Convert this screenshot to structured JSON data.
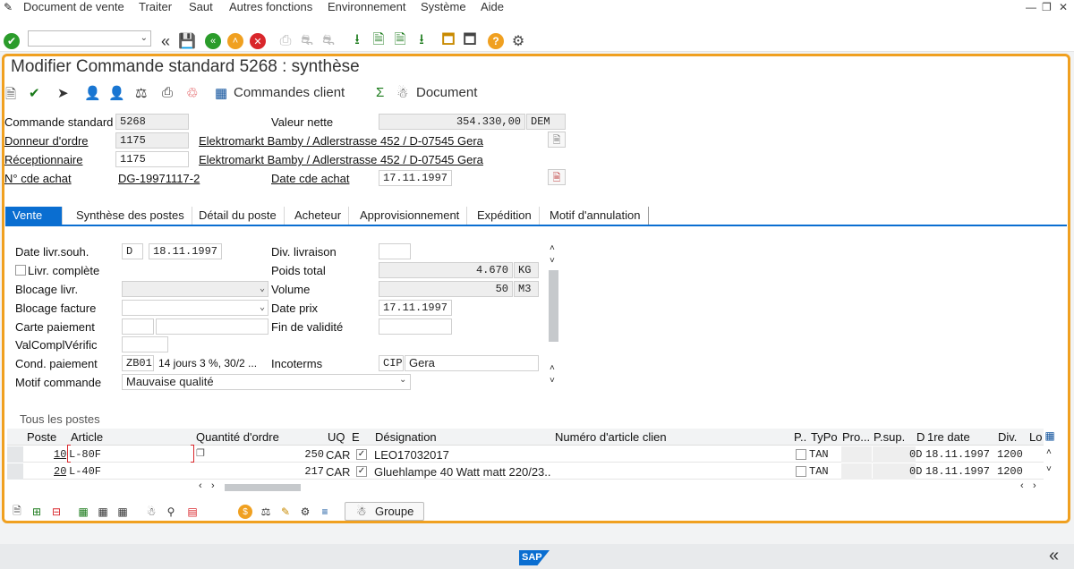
{
  "menu": {
    "items": [
      "Document de vente",
      "Traiter",
      "Saut",
      "Autres fonctions",
      "Environnement",
      "Système",
      "Aide"
    ]
  },
  "title": "Modifier Commande standard 5268 : synthèse",
  "app_toolbar": {
    "commandes_client": "Commandes client",
    "document": "Document"
  },
  "header": {
    "commande_standard_label": "Commande standard",
    "commande_standard_value": "5268",
    "valeur_nette_label": "Valeur nette",
    "valeur_nette_value": "354.330,00",
    "devise": "DEM",
    "donneur_label": "Donneur d'ordre",
    "donneur_value": "1175",
    "donneur_name": "Elektromarkt Bamby / Adlerstrasse 452 / D-07545 Gera",
    "receptionnaire_label": "Réceptionnaire",
    "receptionnaire_value": "1175",
    "receptionnaire_name": "Elektromarkt Bamby / Adlerstrasse 452 / D-07545 Gera",
    "no_cde_label": "N° cde achat",
    "no_cde_value": "DG-19971117-2",
    "date_cde_label": "Date cde achat",
    "date_cde_value": "17.11.1997"
  },
  "tabs": [
    "Vente",
    "Synthèse des postes",
    "Détail du poste",
    "Acheteur",
    "Approvisionnement",
    "Expédition",
    "Motif d'annulation"
  ],
  "vente": {
    "date_livr_label": "Date livr.souh.",
    "date_livr_type": "D",
    "date_livr_value": "18.11.1997",
    "div_livraison_label": "Div. livraison",
    "livr_complete_label": "Livr. complète",
    "poids_total_label": "Poids total",
    "poids_total_value": "4.670",
    "poids_unit": "KG",
    "blocage_livr_label": "Blocage livr.",
    "volume_label": "Volume",
    "volume_value": "50",
    "volume_unit": "M3",
    "blocage_facture_label": "Blocage facture",
    "date_prix_label": "Date prix",
    "date_prix_value": "17.11.1997",
    "carte_paiement_label": "Carte paiement",
    "fin_validite_label": "Fin de validité",
    "valcompl_label": "ValComplVérific",
    "cond_paiement_label": "Cond. paiement",
    "cond_paiement_code": "ZB01",
    "cond_paiement_text": "14 jours 3 %, 30/2 ...",
    "incoterms_label": "Incoterms",
    "incoterms_code": "CIP",
    "incoterms_place": "Gera",
    "motif_commande_label": "Motif commande",
    "motif_commande_value": "Mauvaise qualité"
  },
  "items": {
    "section_title": "Tous les postes",
    "columns": [
      "Poste",
      "Article",
      "Quantité d'ordre",
      "UQ",
      "E",
      "Désignation",
      "Numéro d'article clien",
      "P..",
      "TyPo",
      "Pro...",
      "P.sup.",
      "D",
      "1re date",
      "Div.",
      "Lot"
    ],
    "rows": [
      {
        "poste": "10",
        "article": "L-80F",
        "quantite": "250",
        "uq": "CAR",
        "designation": "LEO17032017",
        "typo": "TAN",
        "d": "0D",
        "date": "18.11.1997",
        "div": "1200"
      },
      {
        "poste": "20",
        "article": "L-40F",
        "quantite": "217",
        "uq": "CAR",
        "designation": "Gluehlampe 40 Watt matt 220/23...",
        "typo": "TAN",
        "d": "0D",
        "date": "18.11.1997",
        "div": "1200"
      }
    ],
    "groupe_label": "Groupe"
  },
  "colors": {
    "accent": "#0a6ed1",
    "frame": "#f0a020",
    "green": "#2b9c2b",
    "red": "#d9262b"
  },
  "icons": {
    "logo": "SAP"
  }
}
